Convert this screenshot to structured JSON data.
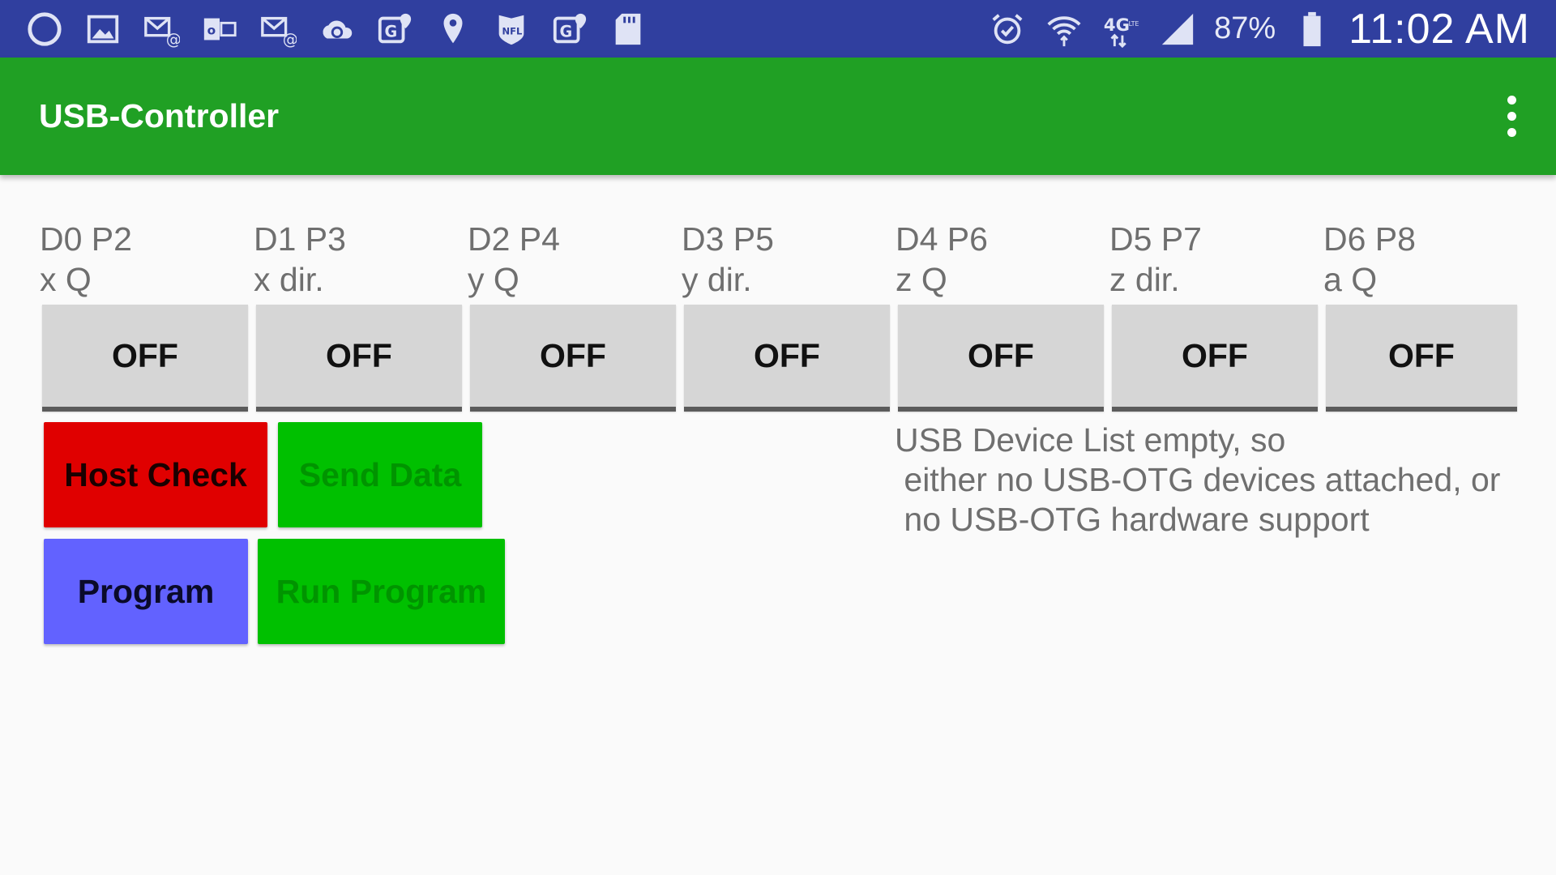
{
  "status_bar": {
    "left_icons": [
      "circle-icon",
      "image-icon",
      "email-icon",
      "outlook-icon",
      "email-icon",
      "cloud-sync-icon",
      "maps-icon",
      "location-pin-icon",
      "nfl-icon",
      "maps-icon",
      "sd-card-icon"
    ],
    "right_icons": [
      "alarm-icon",
      "wifi-icon",
      "4g-lte-icon",
      "signal-icon",
      "battery-icon"
    ],
    "battery_percent": "87%",
    "time": "11:02 AM",
    "color": "#303f9f"
  },
  "app_bar": {
    "title": "USB-Controller",
    "color": "#20a024",
    "overflow_icon": "more-vert-icon"
  },
  "channels": [
    {
      "pin": "D0 P2",
      "desc": "x Q",
      "state": "OFF"
    },
    {
      "pin": "D1 P3",
      "desc": "x dir.",
      "state": "OFF"
    },
    {
      "pin": "D2 P4",
      "desc": "y Q",
      "state": "OFF"
    },
    {
      "pin": "D3 P5",
      "desc": "y dir.",
      "state": "OFF"
    },
    {
      "pin": "D4 P6",
      "desc": "z Q",
      "state": "OFF"
    },
    {
      "pin": "D5 P7",
      "desc": "z dir.",
      "state": "OFF"
    },
    {
      "pin": "D6 P8",
      "desc": "a Q",
      "state": "OFF"
    }
  ],
  "buttons": {
    "host_check": {
      "label": "Host Check",
      "bg": "#e00000",
      "fg": "#1a0000"
    },
    "send_data": {
      "label": "Send Data",
      "bg": "#00c000",
      "fg": "#009400"
    },
    "program": {
      "label": "Program",
      "bg": "#6262ff",
      "fg": "#0a0a2a"
    },
    "run_program": {
      "label": "Run Program",
      "bg": "#00c000",
      "fg": "#009400"
    }
  },
  "usb_message": "USB Device List empty, so\n either no USB-OTG devices attached, or\n no USB-OTG hardware support"
}
